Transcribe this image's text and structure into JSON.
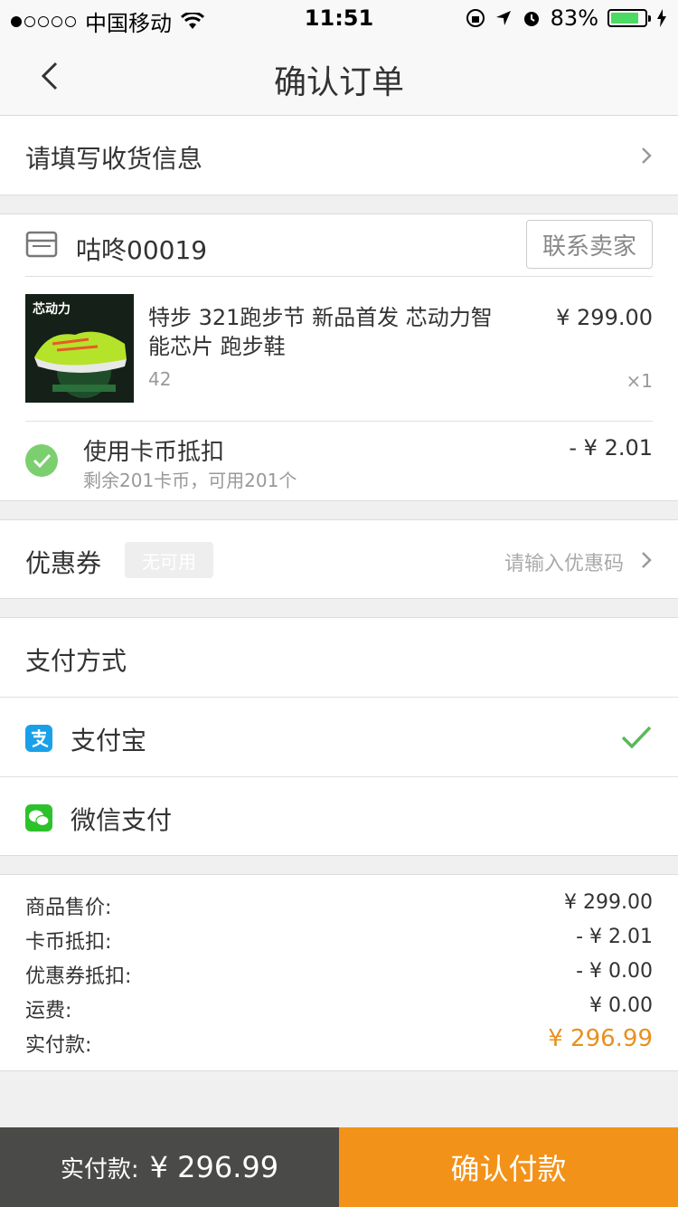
{
  "status_bar": {
    "carrier": "中国移动",
    "time": "11:51",
    "battery": "83%"
  },
  "nav": {
    "title": "确认订单",
    "back_icon": "chevron-left-icon"
  },
  "address": {
    "prompt": "请填写收货信息"
  },
  "shop": {
    "name": "咕咚00019",
    "contact_label": "联系卖家"
  },
  "product": {
    "image_caption": "芯动力",
    "title": "特步 321跑步节  新品首发 芯动力智能芯片 跑步鞋",
    "price": "¥ 299.00",
    "spec": "42",
    "quantity": "×1"
  },
  "coin": {
    "title": "使用卡币抵扣",
    "subtitle": "剩余201卡币，可用201个",
    "amount": "- ¥ 2.01"
  },
  "coupon": {
    "label": "优惠券",
    "badge": "无可用",
    "hint": "请输入优惠码"
  },
  "payment": {
    "header": "支付方式",
    "methods": [
      {
        "label": "支付宝",
        "selected": true,
        "color": "#1aa0e8"
      },
      {
        "label": "微信支付",
        "selected": false,
        "color": "#2cc22c"
      }
    ]
  },
  "summary": {
    "rows": [
      {
        "label": "商品售价:",
        "value": "¥ 299.00"
      },
      {
        "label": "卡币抵扣:",
        "value": "- ¥ 2.01"
      },
      {
        "label": "优惠券抵扣:",
        "value": "- ¥ 0.00"
      },
      {
        "label": "运费:",
        "value": "¥ 0.00"
      },
      {
        "label": "实付款:",
        "value": "¥ 296.99"
      }
    ]
  },
  "footer": {
    "total_label": "实付款:",
    "total_value": "¥ 296.99",
    "confirm_label": "确认付款"
  },
  "colors": {
    "accent": "#f39219",
    "success": "#7ccf6f",
    "footer_dark": "#4a4a48"
  }
}
